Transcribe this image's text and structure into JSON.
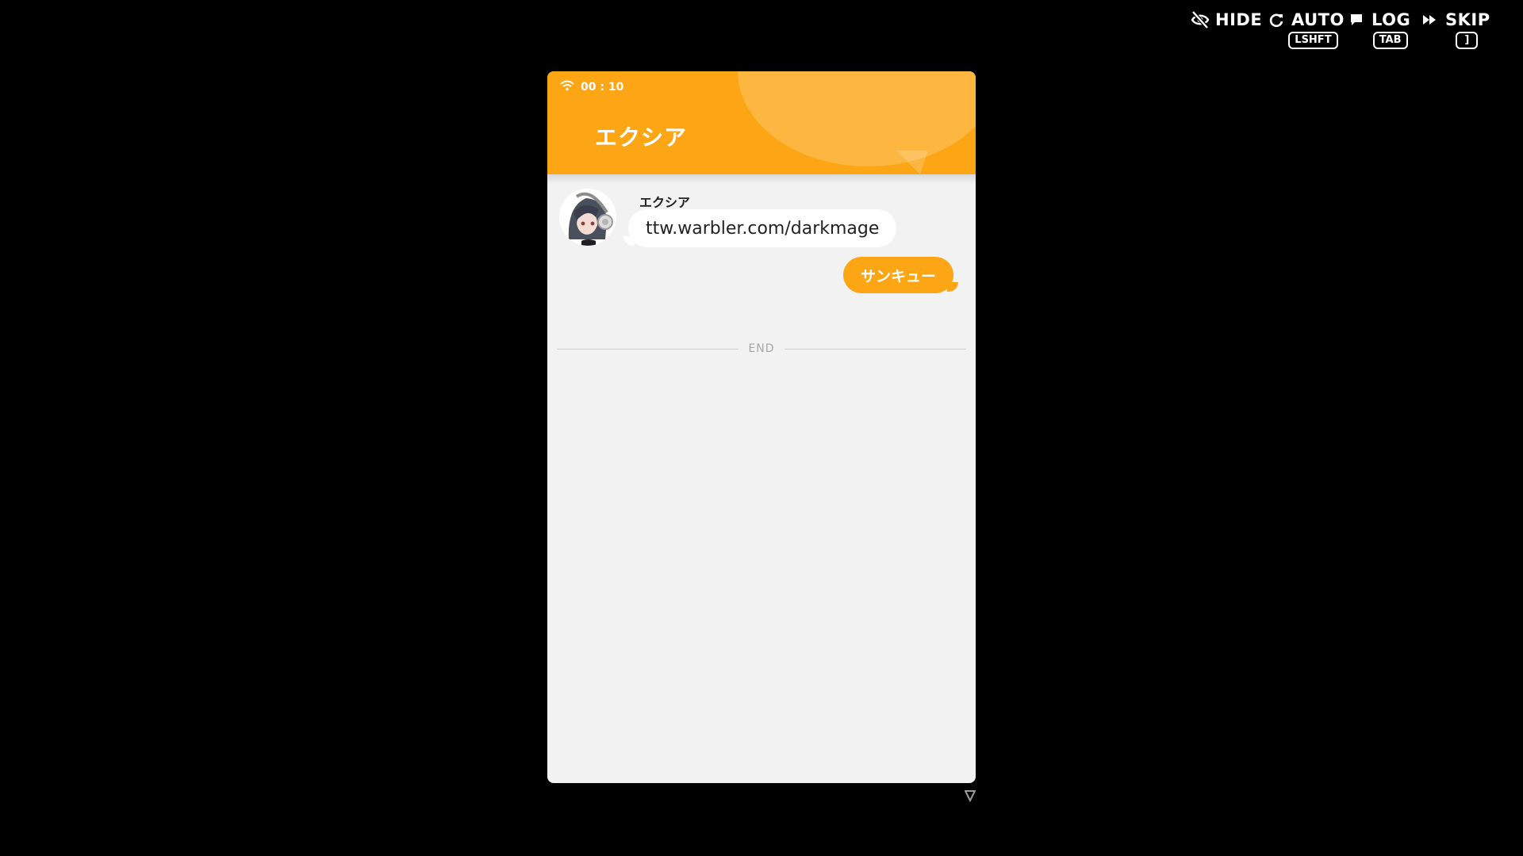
{
  "controls": {
    "hide": {
      "label": "HIDE",
      "icon": "eye-off-icon"
    },
    "auto": {
      "label": "AUTO",
      "icon": "refresh-icon",
      "key": "LSHFT"
    },
    "log": {
      "label": "LOG",
      "icon": "chat-icon",
      "key": "TAB"
    },
    "skip": {
      "label": "SKIP",
      "icon": "fast-forward-icon",
      "key": "]"
    }
  },
  "phone": {
    "status": {
      "time": "00 : 10",
      "icon": "wifi-icon"
    },
    "title": "エクシア",
    "messages": [
      {
        "sender": "エクシア",
        "text": "ttw.warbler.com/darkmage",
        "direction": "incoming"
      },
      {
        "text": "サンキュー",
        "direction": "outgoing"
      }
    ],
    "end_label": "END"
  },
  "colors": {
    "accent": "#fda615",
    "background": "#000000",
    "chat_bg": "#f2f2f2"
  }
}
